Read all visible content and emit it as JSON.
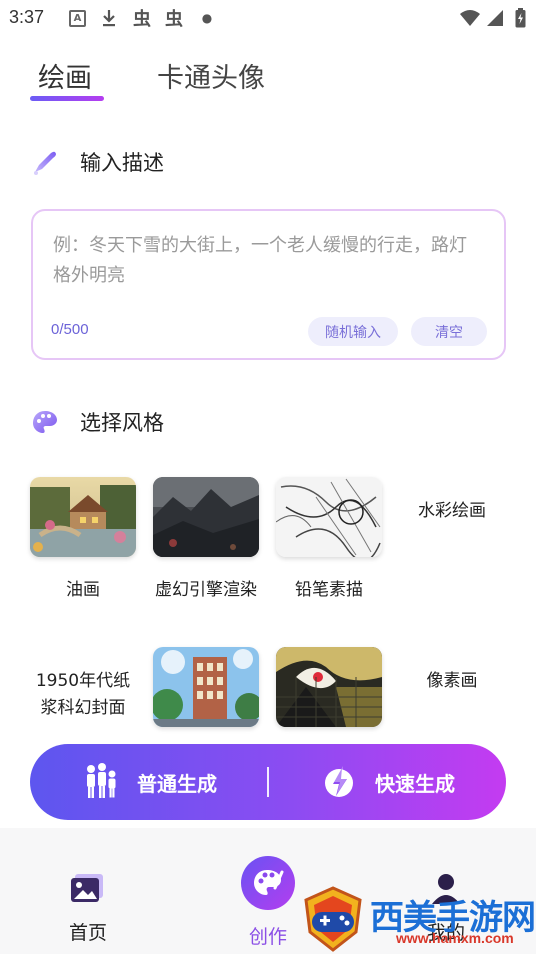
{
  "status_bar": {
    "time": "3:37",
    "icons": [
      "a-box-icon",
      "download-icon",
      "bug-icon",
      "bug-icon",
      "dot-icon",
      "wifi-icon",
      "signal-icon",
      "battery-icon"
    ]
  },
  "tabs": [
    {
      "label": "绘画",
      "active": true
    },
    {
      "label": "卡通头像",
      "active": false
    }
  ],
  "input_section": {
    "heading": "输入描述",
    "placeholder": "例：冬天下雪的大街上，一个老人缓慢的行走，路灯格外明亮",
    "value": "",
    "counter": "0/500",
    "random_button": "随机输入",
    "clear_button": "清空"
  },
  "style_section": {
    "heading": "选择风格",
    "styles": [
      {
        "label": "油画",
        "thumbnail": "cottage-bridge-painting"
      },
      {
        "label": "虚幻引擎渲染",
        "thumbnail": "dark-mountain-landscape"
      },
      {
        "label": "铅笔素描",
        "thumbnail": "pencil-sketch"
      },
      {
        "label": "水彩绘画",
        "thumbnail": ""
      },
      {
        "label": "1950年代纸浆科幻封面",
        "thumbnail": ""
      },
      {
        "label": "",
        "thumbnail": "anime-building-street"
      },
      {
        "label": "",
        "thumbnail": "abstract-art"
      },
      {
        "label": "像素画",
        "thumbnail": ""
      }
    ]
  },
  "generate_bar": {
    "normal": "普通生成",
    "fast": "快速生成"
  },
  "bottom_nav": [
    {
      "label": "首页",
      "icon": "gallery-icon",
      "active": false
    },
    {
      "label": "创作",
      "icon": "palette-icon",
      "active": true
    },
    {
      "label": "我的",
      "icon": "user-icon",
      "active": false
    }
  ],
  "watermark": {
    "title": "西美手游网",
    "url": "www.hamxm.com"
  },
  "colors": {
    "accent_start": "#5d56ef",
    "accent_end": "#c43bf1",
    "input_border": "#e6c6f6",
    "pill_bg": "#eeeefc"
  }
}
